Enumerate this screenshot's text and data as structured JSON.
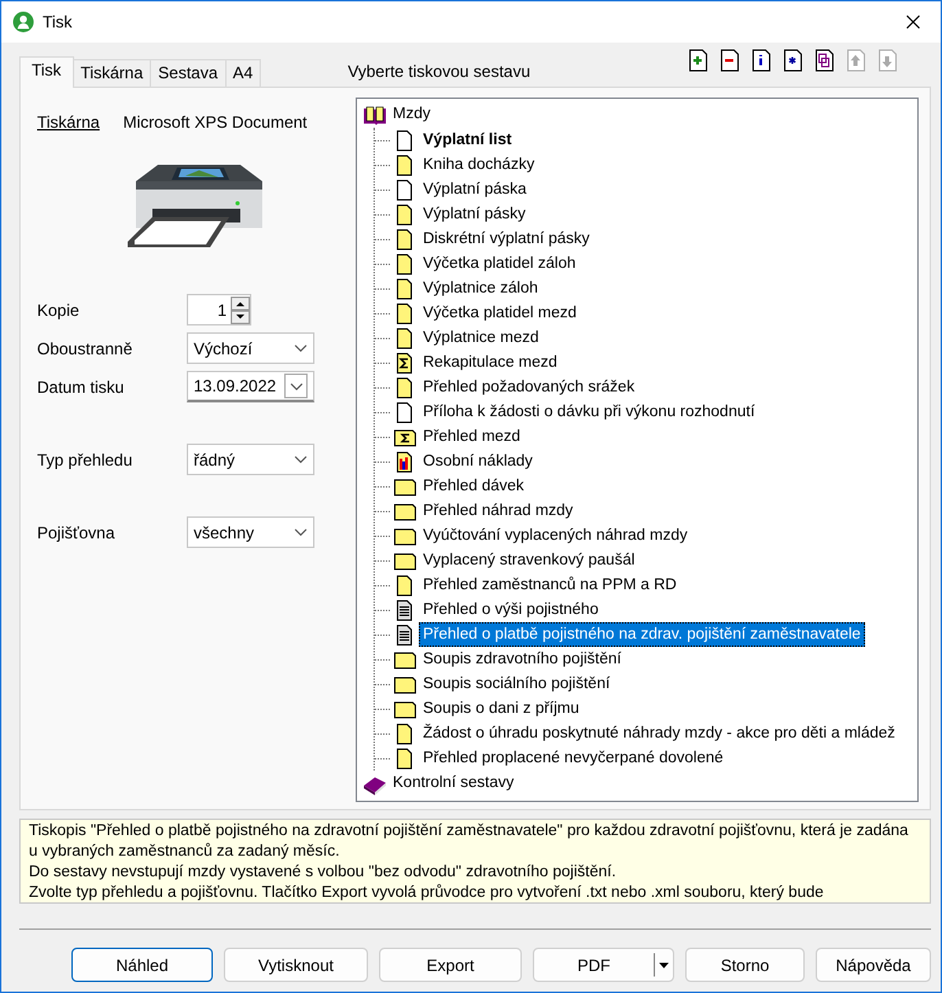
{
  "window": {
    "title": "Tisk"
  },
  "tabs": [
    {
      "label": "Tisk",
      "selected": true
    },
    {
      "label": "Tiskárna",
      "selected": false
    },
    {
      "label": "Sestava",
      "selected": false
    },
    {
      "label": "A4",
      "selected": false
    }
  ],
  "report_header": "Vyberte tiskovou sestavu",
  "toolbar": [
    {
      "kind": "add",
      "disabled": false
    },
    {
      "kind": "remove",
      "disabled": false
    },
    {
      "kind": "info",
      "disabled": false
    },
    {
      "kind": "asterisk",
      "disabled": false
    },
    {
      "kind": "copy",
      "disabled": false
    },
    {
      "kind": "up",
      "disabled": true
    },
    {
      "kind": "down",
      "disabled": true
    }
  ],
  "printer": {
    "label": "Tiskárna",
    "name": "Microsoft XPS Document"
  },
  "field_groups": [
    [
      {
        "label": "Kopie",
        "kind": "spinner",
        "value": "1"
      },
      {
        "label": "Oboustranně",
        "kind": "select",
        "value": "Výchozí"
      },
      {
        "label": "Datum tisku",
        "kind": "date",
        "value": "13.09.2022"
      }
    ],
    [
      {
        "label": "Typ přehledu",
        "kind": "select",
        "value": "řádný"
      }
    ],
    [
      {
        "label": "Pojišťovna",
        "kind": "select",
        "value": "všechny"
      }
    ]
  ],
  "tree": [
    {
      "label": "Mzdy",
      "expanded": true,
      "children": [
        {
          "label": "Výplatní list",
          "kind": "page",
          "bold": true,
          "selected": false
        },
        {
          "label": "Kniha docházky",
          "kind": "yellow",
          "bold": false,
          "selected": false
        },
        {
          "label": "Výplatní páska",
          "kind": "page",
          "bold": false,
          "selected": false
        },
        {
          "label": "Výplatní pásky",
          "kind": "yellow",
          "bold": false,
          "selected": false
        },
        {
          "label": "Diskrétní výplatní pásky",
          "kind": "yellow",
          "bold": false,
          "selected": false
        },
        {
          "label": "Výčetka platidel záloh",
          "kind": "yellow",
          "bold": false,
          "selected": false
        },
        {
          "label": "Výplatnice záloh",
          "kind": "yellow",
          "bold": false,
          "selected": false
        },
        {
          "label": "Výčetka platidel mezd",
          "kind": "yellow",
          "bold": false,
          "selected": false
        },
        {
          "label": "Výplatnice mezd",
          "kind": "yellow",
          "bold": false,
          "selected": false
        },
        {
          "label": "Rekapitulace mezd",
          "kind": "sum",
          "bold": false,
          "selected": false
        },
        {
          "label": "Přehled požadovaných srážek",
          "kind": "yellow",
          "bold": false,
          "selected": false
        },
        {
          "label": "Příloha k žádosti o dávku při výkonu rozhodnutí",
          "kind": "page",
          "bold": false,
          "selected": false
        },
        {
          "label": "Přehled mezd",
          "kind": "sum-landscape",
          "bold": false,
          "selected": false
        },
        {
          "label": "Osobní náklady",
          "kind": "chart",
          "bold": false,
          "selected": false
        },
        {
          "label": "Přehled dávek",
          "kind": "landscape",
          "bold": false,
          "selected": false
        },
        {
          "label": "Přehled náhrad mzdy",
          "kind": "landscape",
          "bold": false,
          "selected": false
        },
        {
          "label": "Vyúčtování vyplacených náhrad mzdy",
          "kind": "landscape",
          "bold": false,
          "selected": false
        },
        {
          "label": "Vyplacený stravenkový paušál",
          "kind": "landscape",
          "bold": false,
          "selected": false
        },
        {
          "label": "Přehled zaměstnanců na PPM a RD",
          "kind": "yellow",
          "bold": false,
          "selected": false
        },
        {
          "label": "Přehled o výši pojistného",
          "kind": "text",
          "bold": false,
          "selected": false
        },
        {
          "label": "Přehled o platbě pojistného na zdrav. pojištění zaměstnavatele",
          "kind": "text",
          "bold": false,
          "selected": true
        },
        {
          "label": "Soupis zdravotního pojištění",
          "kind": "landscape",
          "bold": false,
          "selected": false
        },
        {
          "label": "Soupis sociálního pojištění",
          "kind": "landscape",
          "bold": false,
          "selected": false
        },
        {
          "label": "Soupis o dani z příjmu",
          "kind": "landscape",
          "bold": false,
          "selected": false
        },
        {
          "label": "Žádost o úhradu poskytnuté náhrady mzdy - akce pro děti a mládež",
          "kind": "yellow",
          "bold": false,
          "selected": false
        },
        {
          "label": "Přehled proplacené nevyčerpané dovolené",
          "kind": "yellow",
          "bold": false,
          "selected": false
        }
      ]
    },
    {
      "label": "Kontrolní sestavy",
      "expanded": false
    }
  ],
  "description": [
    "Tiskopis \"Přehled o platbě pojistného na zdravotní pojištění zaměstnavatele\" pro každou zdravotní pojišťovnu, která je zadána u vybraných zaměstnanců za zadaný měsíc.",
    "Do sestavy nevstupují mzdy vystavené s volbou \"bez odvodu\" zdravotního pojištění.",
    "Zvolte typ přehledu a pojišťovnu. Tlačítko Export vyvolá průvodce pro vytvoření .txt nebo .xml souboru, který bude"
  ],
  "buttons": [
    {
      "label": "Náhled",
      "kind": "default"
    },
    {
      "label": "Vytisknout",
      "kind": "normal"
    },
    {
      "label": "Export",
      "kind": "normal"
    },
    {
      "label": "PDF",
      "kind": "split"
    },
    {
      "label": "Storno",
      "kind": "normal"
    },
    {
      "label": "Nápověda",
      "kind": "normal"
    }
  ]
}
